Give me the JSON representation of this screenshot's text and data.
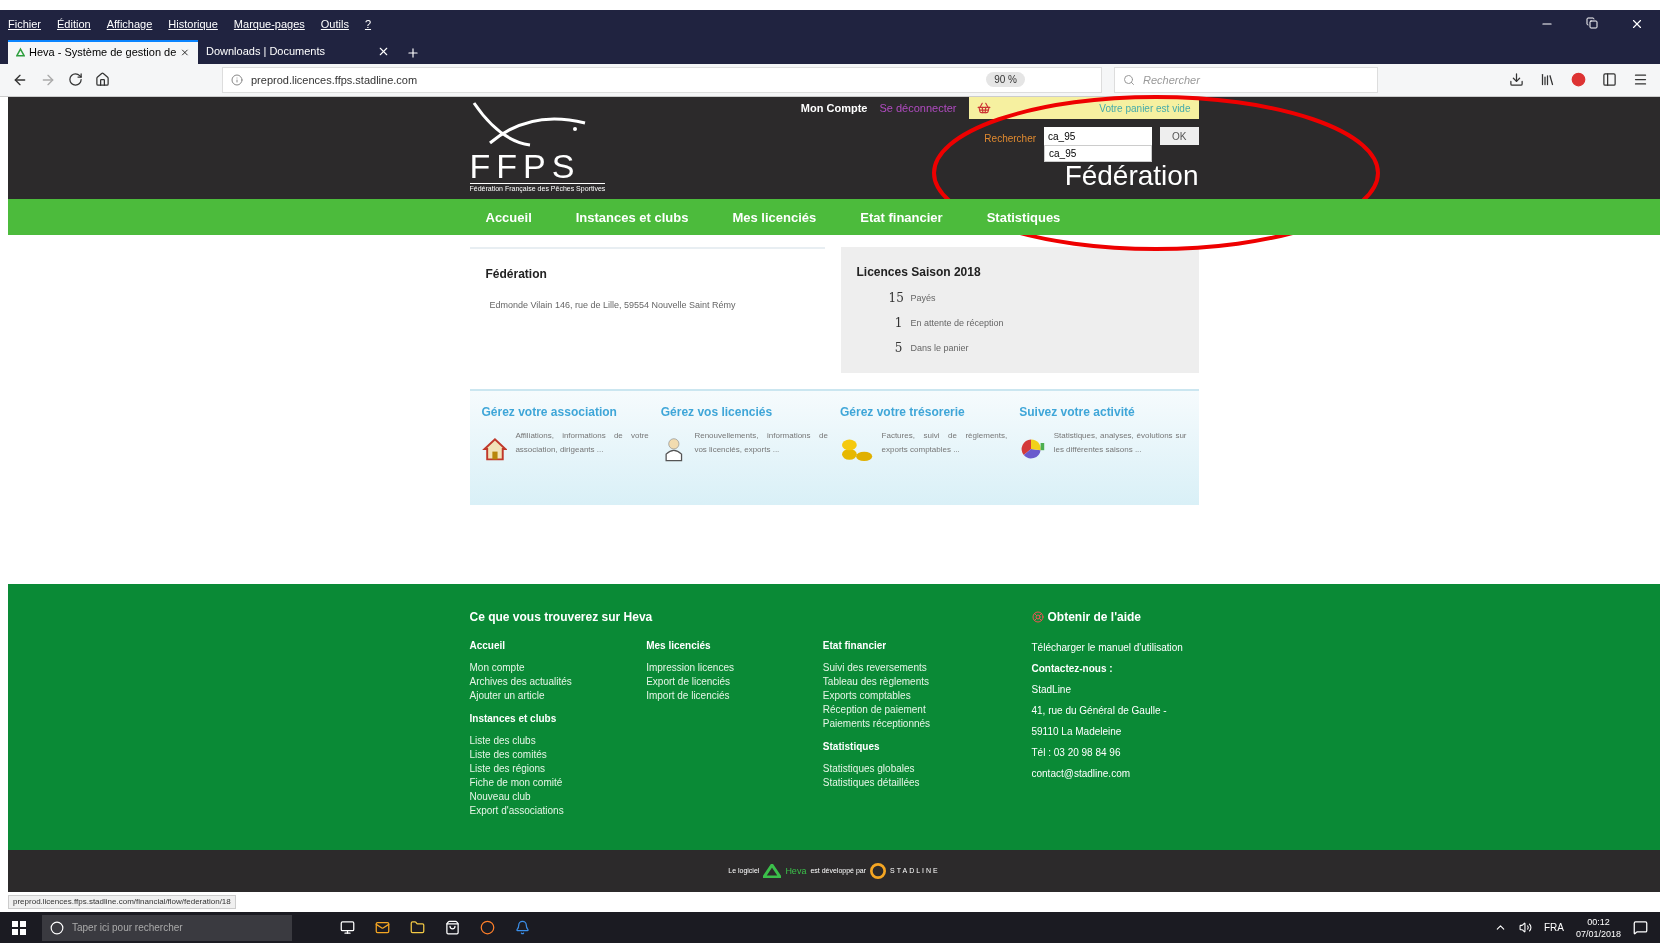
{
  "browser": {
    "menu": [
      "Fichier",
      "Édition",
      "Affichage",
      "Historique",
      "Marque-pages",
      "Outils",
      "?"
    ],
    "tabs": [
      {
        "title": "Heva - Système de gestion de",
        "selected": true
      },
      {
        "title": "Downloads | Documents",
        "selected": false
      }
    ],
    "url": "preprod.licences.ffps.stadline.com",
    "zoom": "90 %",
    "search": {
      "placeholder": "Rechercher"
    }
  },
  "header": {
    "logo": {
      "letters": "FFPS",
      "subtitle": "Fédération Française des Pêches Sportives"
    },
    "account": "Mon Compte",
    "logout": "Se déconnecter",
    "cart": "Votre panier est vide",
    "search": {
      "label": "Rechercher",
      "value": "ca_95",
      "suggestion": "ca_95",
      "button": "OK"
    },
    "role": "Fédération"
  },
  "nav": [
    "Accueil",
    "Instances et clubs",
    "Mes licenciés",
    "Etat financier",
    "Statistiques"
  ],
  "federation": {
    "title": "Fédération",
    "address": "Edmonde Vilain 146, rue de Lille, 59554 Nouvelle Saint Rémy"
  },
  "licences": {
    "title": "Licences Saison 2018",
    "items": [
      {
        "count": "15",
        "label": "Payés"
      },
      {
        "count": "1",
        "label": "En attente de réception"
      },
      {
        "count": "5",
        "label": "Dans le panier"
      }
    ]
  },
  "features": [
    {
      "kind": "house",
      "title": "Gérez votre association",
      "text": "Affiliations, informations de votre association, dirigeants ..."
    },
    {
      "kind": "person",
      "title": "Gérez vos licenciés",
      "text": "Renouvellements, informations de vos licenciés, exports ..."
    },
    {
      "kind": "coins",
      "title": "Gérez votre trésorerie",
      "text": "Factures, suivi de règlements, exports comptables ..."
    },
    {
      "kind": "chart",
      "title": "Suivez votre activité",
      "text": "Statistiques, analyses, évolutions sur les différentes saisons ..."
    }
  ],
  "footer": {
    "title": "Ce que vous trouverez sur Heva",
    "columns": [
      [
        {
          "heading": "Accueil",
          "links": [
            "Mon compte",
            "Archives des actualités",
            "Ajouter un article"
          ]
        },
        {
          "heading": "Instances et clubs",
          "links": [
            "Liste des clubs",
            "Liste des comités",
            "Liste des régions",
            "Fiche de mon comité",
            "Nouveau club",
            "Export d'associations"
          ]
        }
      ],
      [
        {
          "heading": "Mes licenciés",
          "links": [
            "Impression licences",
            "Export de licenciés",
            "Import de licenciés"
          ]
        }
      ],
      [
        {
          "heading": "Etat financier",
          "links": [
            "Suivi des reversements",
            "Tableau des règlements",
            "Exports comptables",
            "Réception de paiement",
            "Paiements réceptionnés"
          ]
        },
        {
          "heading": "Statistiques",
          "links": [
            "Statistiques globales",
            "Statistiques détaillées"
          ]
        }
      ]
    ],
    "help": {
      "title": "Obtenir de l'aide",
      "manual": "Télécharger le manuel d'utilisation",
      "contact_heading": "Contactez-nous :",
      "lines": [
        "StadLine",
        "41, rue du Général de Gaulle -",
        "59110 La Madeleine",
        "Tél : 03 20 98 84 96",
        "contact@stadline.com"
      ]
    },
    "credit": {
      "prefix": "Le logiciel",
      "product": "Heva",
      "middle": "est développé par",
      "company": "STADLINE"
    }
  },
  "status_url": "preprod.licences.ffps.stadline.com/financial/flow/federation/18",
  "taskbar": {
    "search": {
      "placeholder": "Taper ici pour rechercher"
    },
    "language": "FRA",
    "time": "00:12",
    "date": "07/01/2018"
  }
}
